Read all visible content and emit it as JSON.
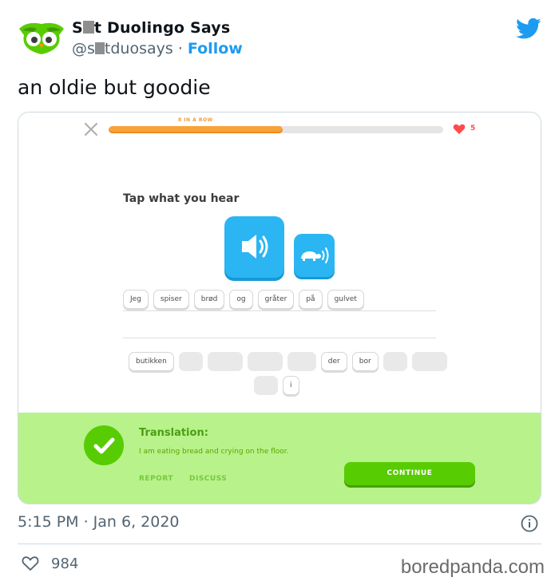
{
  "tweet": {
    "author_name_prefix": "S",
    "author_name_suffix": "t Duolingo Says",
    "handle_prefix": "@s",
    "handle_suffix": "tduosays",
    "separator": "·",
    "follow_label": "Follow",
    "text": "an oldie but goodie",
    "timestamp": "5:15 PM · Jan 6, 2020",
    "like_count": "984",
    "watermark": "boredpanda.com"
  },
  "lesson": {
    "streak_label": "8 IN A ROW",
    "progress": 0.52,
    "hearts": "5",
    "prompt": "Tap what you hear",
    "answer_tokens": [
      "Jeg",
      "spiser",
      "brød",
      "og",
      "gråter",
      "på",
      "gulvet"
    ],
    "bank_row1": [
      {
        "text": "butikken"
      },
      {
        "text": "",
        "empty": true
      },
      {
        "text": "",
        "empty": true
      },
      {
        "text": "",
        "empty": true
      },
      {
        "text": "",
        "empty": true
      },
      {
        "text": "der"
      },
      {
        "text": "bor"
      },
      {
        "text": "",
        "empty": true
      },
      {
        "text": "",
        "empty": true
      }
    ],
    "bank_row2": [
      {
        "text": "",
        "empty": true
      },
      {
        "text": "i"
      }
    ],
    "translation_title": "Translation:",
    "translation_text": "I am eating bread and crying on the floor.",
    "report_label": "REPORT",
    "discuss_label": "DISCUSS",
    "continue_label": "CONTINUE"
  },
  "colors": {
    "twitter_blue": "#1d9bf0",
    "duo_green": "#58cc02",
    "panel_green": "#b8f28b",
    "speaker_blue": "#2bb5f3",
    "progress_orange": "#f7a33a",
    "heart_red": "#ff4b4b"
  },
  "icons": {
    "avatar": "green-owl-avatar",
    "brand": "twitter-bird-icon",
    "close": "close-icon",
    "heart": "heart-icon",
    "audio": "speaker-icon",
    "slow_audio": "turtle-speaker-icon",
    "correct": "checkmark-icon",
    "info": "info-icon",
    "like": "like-heart-icon"
  }
}
